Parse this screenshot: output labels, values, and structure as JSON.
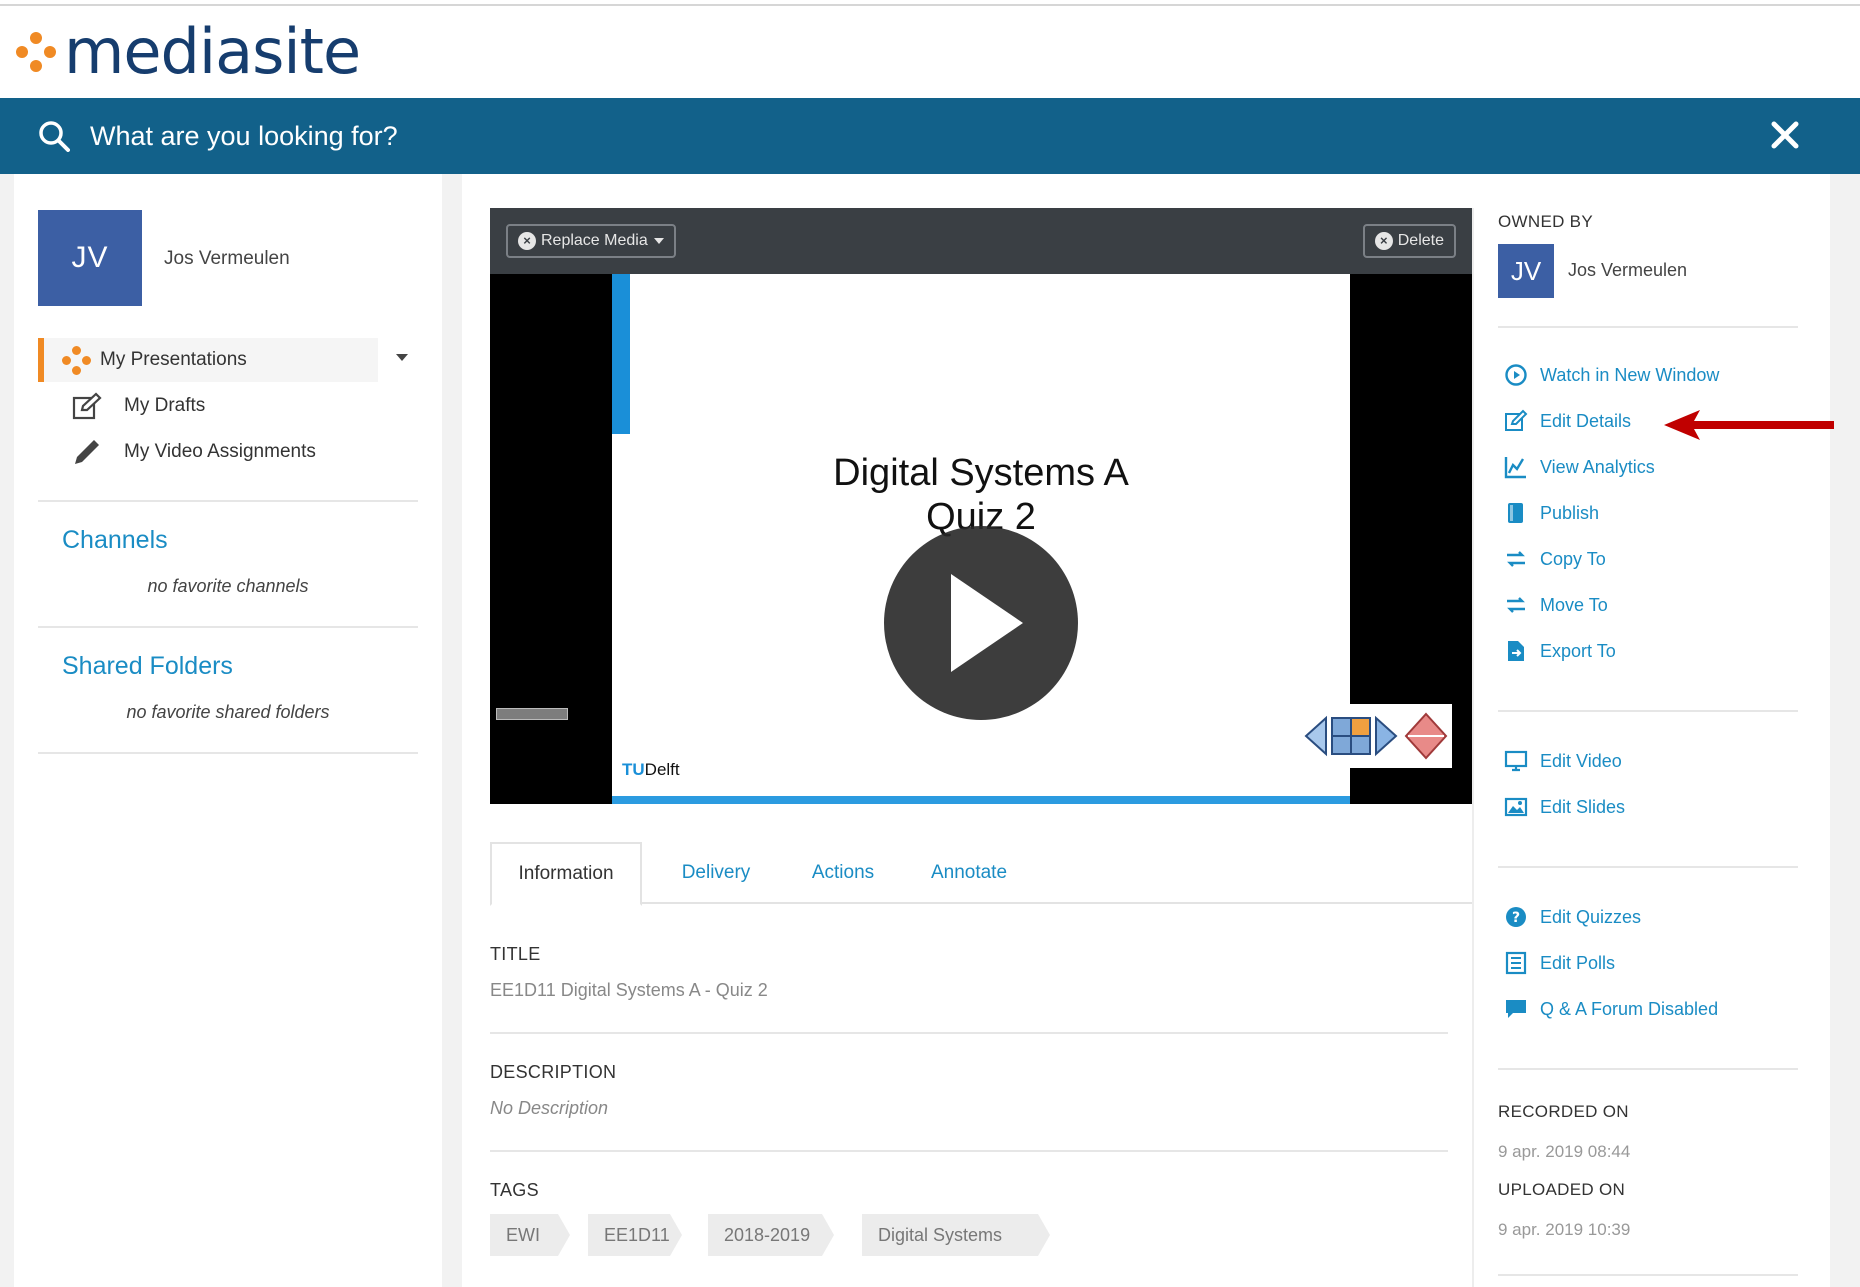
{
  "logo": {
    "text": "mediasite",
    "color": "#163d6e",
    "dot_color": "#f08a24"
  },
  "search": {
    "placeholder": "What are you looking for?",
    "bar_color": "#12618a"
  },
  "sidebar": {
    "user": {
      "initials": "JV",
      "name": "Jos Vermeulen"
    },
    "nav": [
      {
        "label": "My Presentations",
        "icon": "presentations-icon",
        "active": true
      },
      {
        "label": "My Drafts",
        "icon": "edit-icon"
      },
      {
        "label": "My Video Assignments",
        "icon": "pencil-icon"
      }
    ],
    "channels": {
      "heading": "Channels",
      "empty": "no favorite channels"
    },
    "shared_folders": {
      "heading": "Shared Folders",
      "empty": "no favorite shared folders"
    }
  },
  "player": {
    "replace_media_label": "Replace Media",
    "delete_label": "Delete",
    "slide_title": "Digital Systems A",
    "slide_subtitle": "Quiz 2",
    "slide_logo": {
      "prefix": "TU",
      "suffix": "Delft"
    }
  },
  "tabs": [
    {
      "label": "Information",
      "active": true
    },
    {
      "label": "Delivery"
    },
    {
      "label": "Actions"
    },
    {
      "label": "Annotate"
    }
  ],
  "details": {
    "title_label": "TITLE",
    "title_value": "EE1D11 Digital Systems A - Quiz 2",
    "description_label": "DESCRIPTION",
    "description_value": "No Description",
    "tags_label": "TAGS",
    "tags": [
      "EWI",
      "EE1D11",
      "2018-2019",
      "Digital Systems"
    ]
  },
  "owner": {
    "label": "OWNED BY",
    "initials": "JV",
    "name": "Jos Vermeulen"
  },
  "actions": {
    "group1": [
      {
        "label": "Watch in New Window",
        "icon": "play-circle-icon"
      },
      {
        "label": "Edit Details",
        "icon": "edit-icon"
      },
      {
        "label": "View Analytics",
        "icon": "analytics-icon"
      },
      {
        "label": "Publish",
        "icon": "publish-icon"
      },
      {
        "label": "Copy To",
        "icon": "transfer-icon"
      },
      {
        "label": "Move To",
        "icon": "transfer-icon"
      },
      {
        "label": "Export To",
        "icon": "export-icon"
      }
    ],
    "group2": [
      {
        "label": "Edit Video",
        "icon": "monitor-icon"
      },
      {
        "label": "Edit Slides",
        "icon": "image-icon"
      }
    ],
    "group3": [
      {
        "label": "Edit Quizzes",
        "icon": "question-icon"
      },
      {
        "label": "Edit Polls",
        "icon": "list-icon"
      },
      {
        "label": "Q & A Forum Disabled",
        "icon": "chat-icon"
      }
    ]
  },
  "recording": {
    "recorded_label": "RECORDED ON",
    "recorded_value": "9 apr. 2019 08:44",
    "uploaded_label": "UPLOADED ON",
    "uploaded_value": "9 apr. 2019 10:39"
  },
  "colors": {
    "link": "#1a8cc4",
    "accent": "#f08a24",
    "avatar": "#3c5fa4",
    "annotation_arrow": "#c00000"
  }
}
